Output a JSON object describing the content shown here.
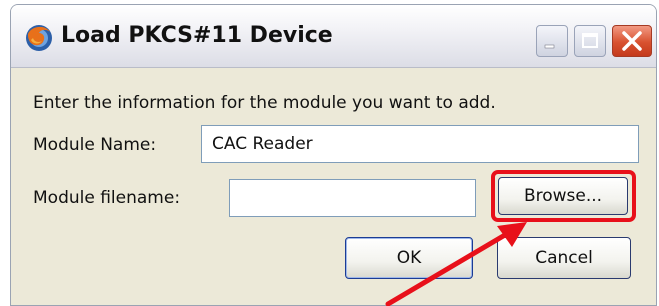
{
  "window": {
    "title": "Load PKCS#11 Device",
    "controls": {
      "minimize_icon": "minimize-icon",
      "maximize_icon": "maximize-icon",
      "close_icon": "close-icon"
    }
  },
  "dialog": {
    "instruction": "Enter the information for the module you want to add.",
    "module_name": {
      "label": "Module Name:",
      "value": "CAC Reader"
    },
    "module_filename": {
      "label": "Module filename:",
      "value": ""
    },
    "browse_label": "Browse...",
    "ok_label": "OK",
    "cancel_label": "Cancel"
  },
  "annotation": {
    "highlight_color": "#e8101a",
    "arrow_color": "#e8101a"
  }
}
